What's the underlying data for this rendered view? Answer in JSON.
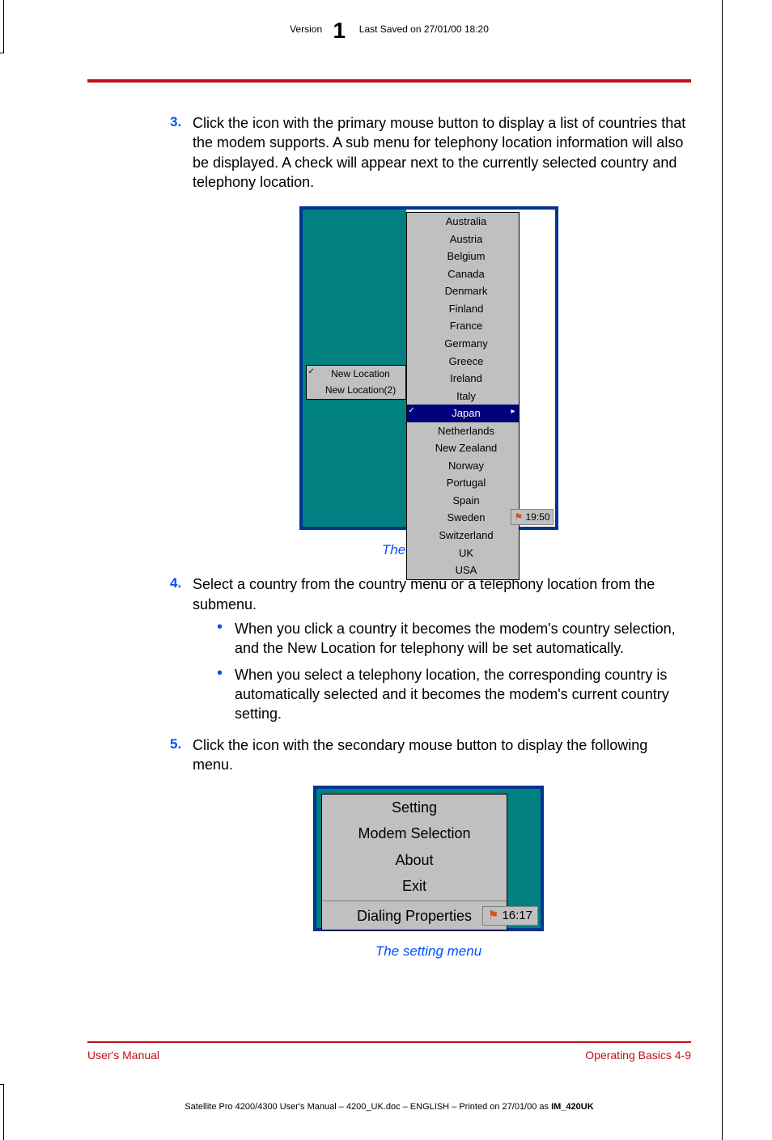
{
  "header": {
    "version_label": "Version",
    "version_number": "1",
    "saved": "Last Saved on 27/01/00 18:20"
  },
  "steps": {
    "s3": {
      "num": "3.",
      "text": "Click the icon with the primary mouse button to display a list of countries that the modem supports. A sub menu for telephony location information will also be displayed. A check will appear next to the currently selected country and telephony location."
    },
    "s4": {
      "num": "4.",
      "text": "Select a country from the country menu or a telephony location from the submenu."
    },
    "s5": {
      "num": "5.",
      "text": "Click the icon with the secondary mouse button to display the following menu."
    }
  },
  "bullets": {
    "b1": "When you click a country it becomes the modem's country selection, and the New Location for telephony will be set automatically.",
    "b2": "When you select a telephony location, the corresponding country is automatically selected and it becomes the modem's current country setting."
  },
  "fig1": {
    "loc1": "New Location",
    "loc2": "New Location(2)",
    "countries": {
      "c0": "Australia",
      "c1": "Austria",
      "c2": "Belgium",
      "c3": "Canada",
      "c4": "Denmark",
      "c5": "Finland",
      "c6": "France",
      "c7": "Germany",
      "c8": "Greece",
      "c9": "Ireland",
      "c10": "Italy",
      "c11": "Japan",
      "c12": "Netherlands",
      "c13": "New Zealand",
      "c14": "Norway",
      "c15": "Portugal",
      "c16": "Spain",
      "c17": "Sweden",
      "c18": "Switzerland",
      "c19": "UK",
      "c20": "USA"
    },
    "clock": "19:50",
    "caption": "The country list"
  },
  "fig2": {
    "m0": "Setting",
    "m1": "Modem Selection",
    "m2": "About",
    "m3": "Exit",
    "m4": "Dialing Properties",
    "clock": "16:17",
    "caption": "The setting menu"
  },
  "footer": {
    "left": "User's Manual",
    "right": "Operating Basics  4-9"
  },
  "footfoot": {
    "text": "Satellite Pro 4200/4300 User's Manual  – 4200_UK.doc – ENGLISH – Printed on 27/01/00 as ",
    "bold": "IM_420UK"
  }
}
